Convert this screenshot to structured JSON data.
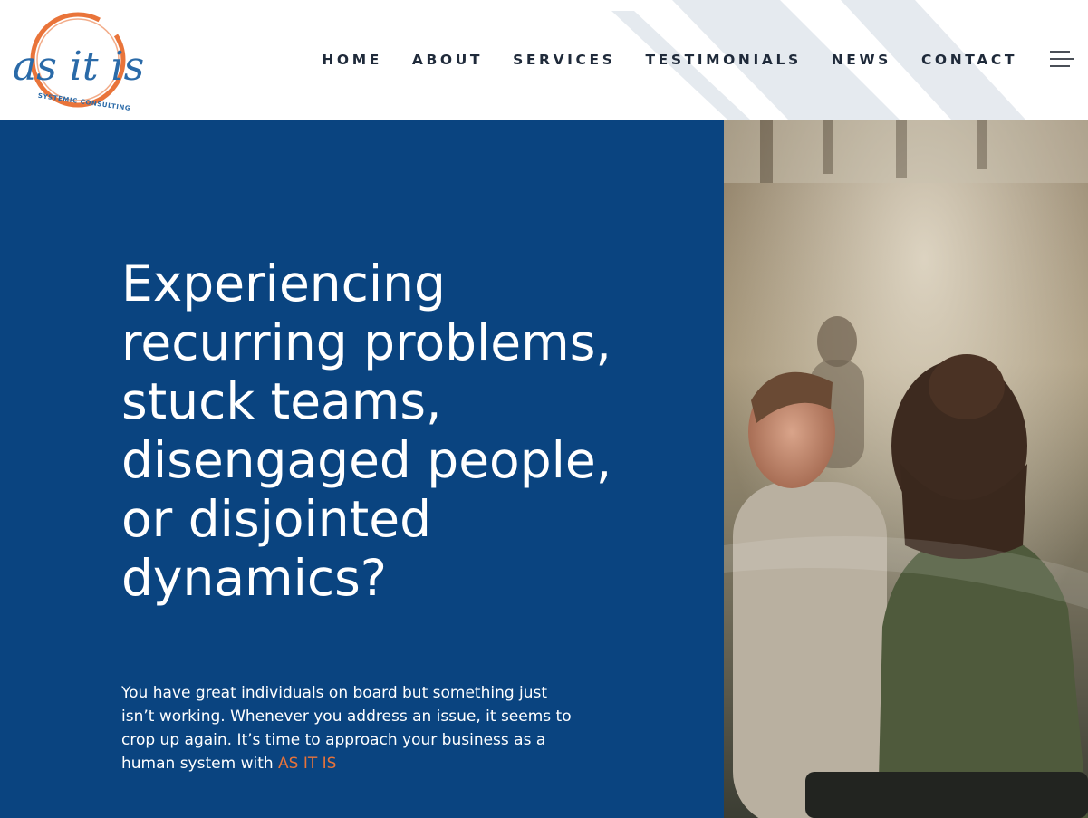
{
  "brand": {
    "logo_text": "as it is",
    "logo_subtext": "SYSTEMIC CONSULTING",
    "colors": {
      "navy": "#0a4480",
      "orange": "#e9743a",
      "nav_text": "#1f2a3a"
    }
  },
  "nav": {
    "items": [
      {
        "label": "HOME"
      },
      {
        "label": "ABOUT"
      },
      {
        "label": "SERVICES"
      },
      {
        "label": "TESTIMONIALS"
      },
      {
        "label": "NEWS"
      },
      {
        "label": "CONTACT"
      }
    ],
    "menu_icon": "hamburger-icon"
  },
  "hero": {
    "title": "Experiencing recurring problems, stuck teams, disengaged people, or disjointed dynamics?",
    "body": "You have great individuals on board but something just isn’t working. Whenever you address an issue, it seems to crop up again. It’s time to approach your business as a human system with ",
    "body_accent": "AS IT IS"
  }
}
